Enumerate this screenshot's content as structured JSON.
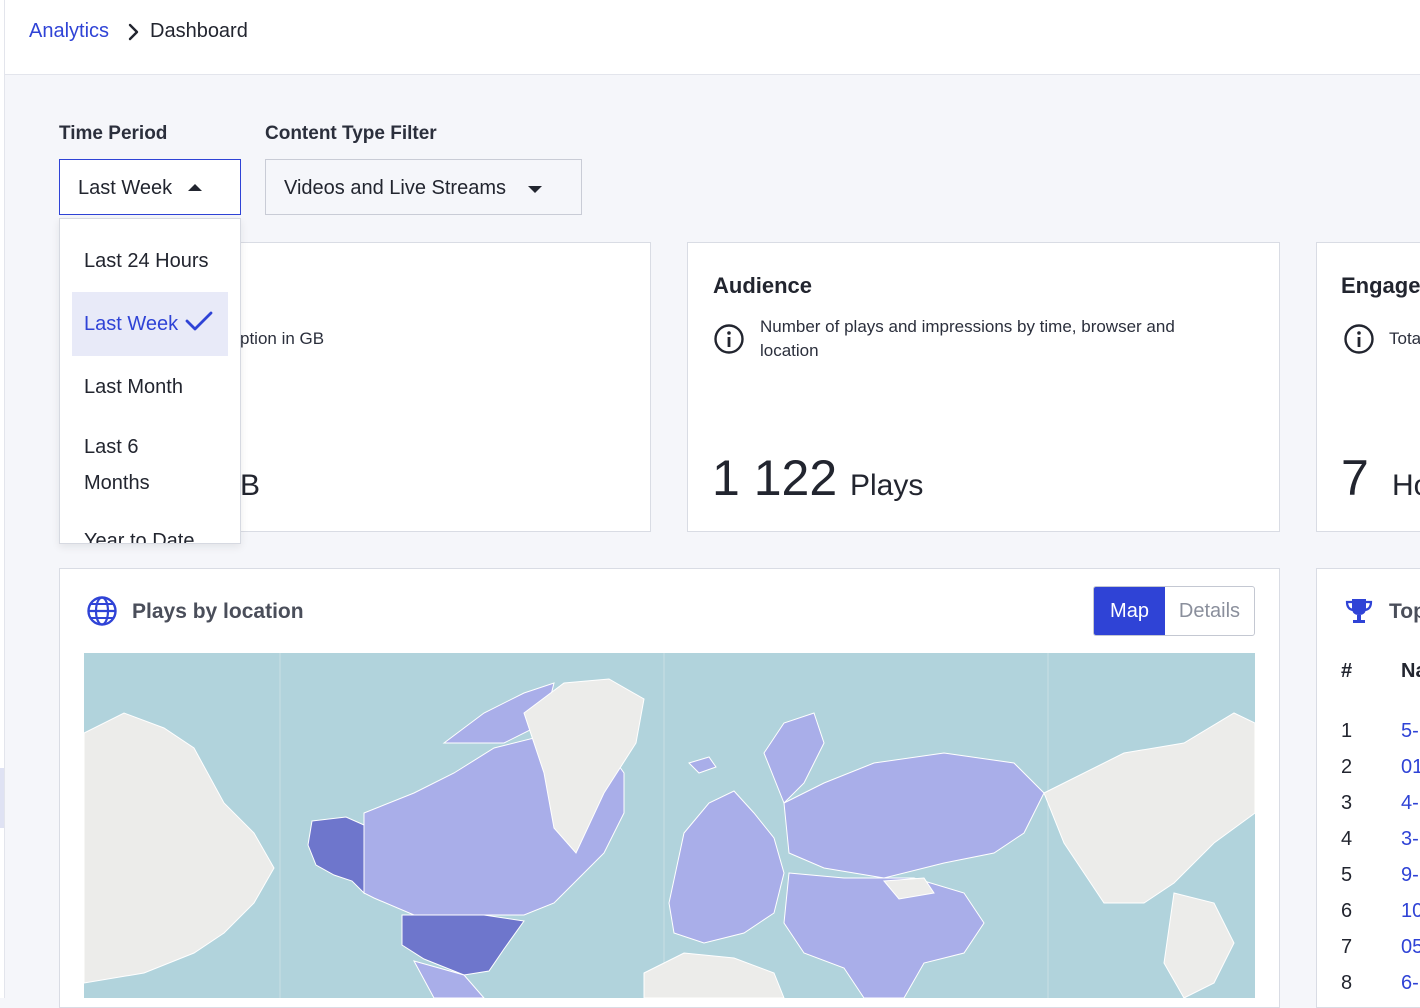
{
  "breadcrumb": {
    "root": "Analytics",
    "current": "Dashboard"
  },
  "filters": {
    "time_period": {
      "label": "Time Period",
      "value": "Last Week",
      "options": [
        "Last 24 Hours",
        "Last Week",
        "Last Month",
        "Last 6 Months",
        "Year to Date"
      ]
    },
    "content_type": {
      "label": "Content Type Filter",
      "value": "Videos and Live Streams"
    }
  },
  "cards": {
    "usage": {
      "description_partial": "ption in GB",
      "unit_partial": "B"
    },
    "audience": {
      "title": "Audience",
      "description": "Number of plays and impressions by time, browser and location",
      "value": "1 122",
      "unit": "Plays"
    },
    "engagement": {
      "title": "Engage",
      "description_partial": "Tota",
      "value": "7",
      "unit_partial": "Ho"
    }
  },
  "plays_by_location": {
    "title": "Plays by location",
    "toggle": {
      "map": "Map",
      "details": "Details",
      "active": "map"
    }
  },
  "top_list": {
    "title_partial": "Top",
    "col_rank": "#",
    "col_name": "Na",
    "rows": [
      {
        "rank": "1",
        "name": "5-"
      },
      {
        "rank": "2",
        "name": "01"
      },
      {
        "rank": "3",
        "name": "4-"
      },
      {
        "rank": "4",
        "name": "3-"
      },
      {
        "rank": "5",
        "name": "9-"
      },
      {
        "rank": "6",
        "name": "10"
      },
      {
        "rank": "7",
        "name": "05"
      },
      {
        "rank": "8",
        "name": "6-"
      }
    ]
  },
  "colors": {
    "accent": "#2f43d6",
    "map_ocean": "#b1d3dc",
    "map_high": "#6e76cc",
    "map_mid": "#a9aee9",
    "map_land": "#ececea"
  }
}
